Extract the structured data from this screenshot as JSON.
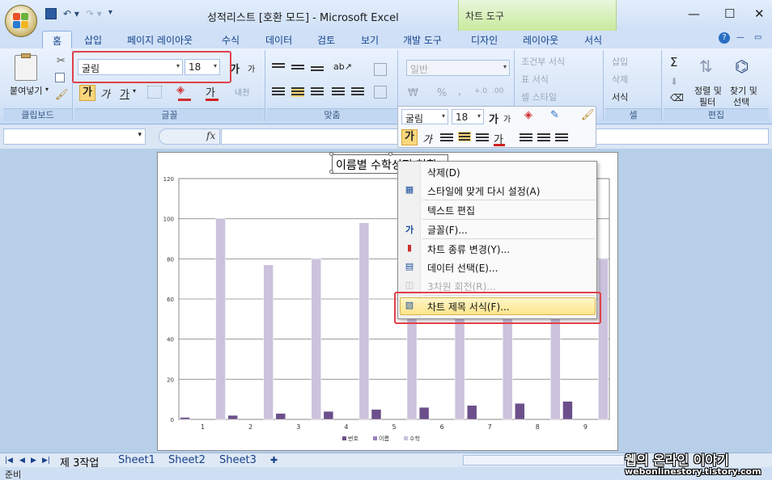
{
  "window": {
    "title": "성적리스트 [호환 모드] - Microsoft Excel",
    "context_tab_title": "차트 도구",
    "controls": [
      "—",
      "☐",
      "✕"
    ]
  },
  "ribbon_tabs": [
    {
      "label": "홈",
      "active": true
    },
    {
      "label": "삽입"
    },
    {
      "label": "페이지 레이아웃"
    },
    {
      "label": "수식"
    },
    {
      "label": "데이터"
    },
    {
      "label": "검토"
    },
    {
      "label": "보기"
    },
    {
      "label": "개발 도구"
    },
    {
      "label": "디자인"
    },
    {
      "label": "레이아웃"
    },
    {
      "label": "서식"
    }
  ],
  "ribbon": {
    "clipboard": {
      "paste_label": "붙여넣기",
      "group_label": "클립보드"
    },
    "font": {
      "font_name": "굴림",
      "font_size": "18",
      "bold": "가",
      "italic": "가",
      "underline": "가",
      "font_color_label": "가",
      "group_label": "글꼴",
      "grow": "가",
      "shrink": "가",
      "phonetic": "내천"
    },
    "alignment": {
      "group_label": "맞춤"
    },
    "number": {
      "format": "일반",
      "percent": "%",
      "comma": ",",
      "currency": "₩"
    },
    "styles": {
      "conditional": "조건부 서식",
      "table": "표 서식",
      "cell": "셀 스타일"
    },
    "cells": {
      "insert": "삽입",
      "delete": "삭제",
      "format": "서식",
      "group_label": "셀"
    },
    "editing": {
      "sigma": "Σ",
      "sort": "정렬 및 필터",
      "sort_line1": "정렬 및",
      "sort_line2": "필터",
      "find": "찾기 및 선택",
      "find_line1": "찾기 및",
      "find_line2": "선택",
      "group_label": "편집"
    }
  },
  "formula_bar": {
    "fx": "fx",
    "value": ""
  },
  "chart": {
    "title_text": "이름별 수학성적 현황",
    "legend": [
      "번호",
      "이름",
      "수학"
    ]
  },
  "chart_data": {
    "type": "bar",
    "categories": [
      "1",
      "2",
      "3",
      "4",
      "5",
      "6",
      "7",
      "8",
      "9"
    ],
    "ylim": [
      0,
      120
    ],
    "yticks": [
      "0",
      "20",
      "40",
      "60",
      "80",
      "100",
      "120"
    ],
    "series": [
      {
        "name": "번호",
        "values": [
          1,
          2,
          3,
          4,
          5,
          6,
          7,
          8,
          9
        ],
        "color": "#6b4f8a"
      },
      {
        "name": "이름",
        "values": [
          0,
          0,
          0,
          0,
          0,
          0,
          0,
          0,
          0
        ],
        "color": "#9b7fbf"
      },
      {
        "name": "수학",
        "values": [
          100,
          77,
          80,
          98,
          87,
          90,
          85,
          92,
          80
        ],
        "color": "#ccc2dd"
      }
    ]
  },
  "mini_toolbar": {
    "font_name": "굴림",
    "font_size": "18",
    "bold": "가",
    "italic": "가",
    "grow": "가",
    "shrink": "가",
    "color": "가"
  },
  "context_menu": {
    "items": [
      {
        "label": "삭제(D)"
      },
      {
        "label": "스타일에 맞게 다시 설정(A)"
      },
      {
        "label": "텍스트 편집"
      },
      {
        "label": "글꼴(F)..."
      },
      {
        "label": "차트 종류 변경(Y)..."
      },
      {
        "label": "데이터 선택(E)..."
      },
      {
        "label": "3차원 회전(R)..."
      },
      {
        "label": "차트 제목 서식(F)..."
      }
    ]
  },
  "sheet_tabs": [
    "제 3작업",
    "Sheet1",
    "Sheet2",
    "Sheet3"
  ],
  "status": {
    "ready": "준비"
  },
  "watermark": {
    "line1": "웹의 온라인 이야기",
    "line2": "webonlinestory.tistory.com"
  }
}
